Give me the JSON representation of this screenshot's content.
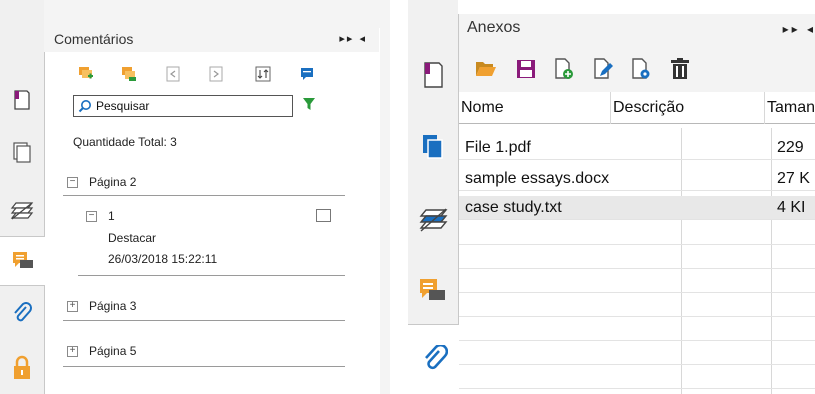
{
  "left_panel": {
    "title": "Comentários",
    "header_controls": "▸▸ ◂",
    "toolbar_icons": [
      "add-comment-icon",
      "add-reply-icon",
      "collapse-icon",
      "expand-icon",
      "sort-icon",
      "comment-icon"
    ],
    "search": {
      "placeholder": "Pesquisar"
    },
    "total_label": "Quantidade Total: 3",
    "pages": [
      {
        "label": "Página 2",
        "expanded": true,
        "comments": [
          {
            "number": "1",
            "type": "Destacar",
            "date": "26/03/2018 15:22:11"
          }
        ]
      },
      {
        "label": "Página 3",
        "expanded": false
      },
      {
        "label": "Página 5",
        "expanded": false
      }
    ],
    "rail_icons": [
      "bookmark-icon",
      "pages-icon",
      "layers-icon",
      "comments-icon",
      "attachment-icon",
      "lock-icon"
    ],
    "active_tab": "comments-icon"
  },
  "right_panel": {
    "title": "Anexos",
    "header_controls": "▸▸ ◂",
    "toolbar_icons": [
      "open-folder-icon",
      "save-icon",
      "add-file-icon",
      "edit-file-icon",
      "file-settings-icon",
      "delete-icon"
    ],
    "columns": [
      "Nome",
      "Descrição",
      "Taman"
    ],
    "rows": [
      {
        "name": "File 1.pdf",
        "description": "",
        "size": "229"
      },
      {
        "name": "sample essays.docx",
        "description": "",
        "size": "27 K"
      },
      {
        "name": "case study.txt",
        "description": "",
        "size": "4 KI"
      }
    ],
    "selected_row": 2,
    "rail_icons": [
      "bookmark-icon",
      "pages-icon",
      "layers-icon",
      "comments-icon",
      "attachment-icon"
    ],
    "active_tab": "attachment-icon"
  },
  "colors": {
    "comment_orange": "#f0a030",
    "accent_blue": "#1a6fc0",
    "save_purple": "#8a1a7a",
    "filter_green": "#2a9a3a"
  }
}
